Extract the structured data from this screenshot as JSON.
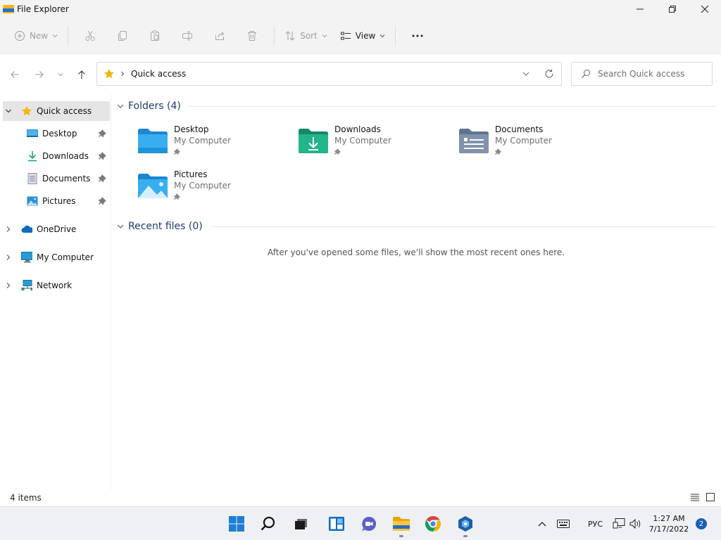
{
  "window": {
    "title": "File Explorer",
    "controls": [
      "minimize-icon",
      "restore-icon",
      "close-icon"
    ]
  },
  "toolbar": {
    "new_label": "New",
    "sort_label": "Sort",
    "view_label": "View",
    "items": [
      "cut-icon",
      "copy-icon",
      "paste-icon",
      "rename-icon",
      "share-icon",
      "delete-icon",
      "more-icon"
    ]
  },
  "address": {
    "path_label": "Quick access",
    "search_placeholder": "Search Quick access"
  },
  "sidebar": {
    "quick_access": "Quick access",
    "pinned": [
      {
        "label": "Desktop",
        "icon": "desktop-icon"
      },
      {
        "label": "Downloads",
        "icon": "downloads-icon"
      },
      {
        "label": "Documents",
        "icon": "documents-icon"
      },
      {
        "label": "Pictures",
        "icon": "pictures-icon"
      }
    ],
    "roots": [
      {
        "label": "OneDrive",
        "icon": "onedrive-icon"
      },
      {
        "label": "My Computer",
        "icon": "computer-icon"
      },
      {
        "label": "Network",
        "icon": "network-icon"
      }
    ]
  },
  "main": {
    "folders_header": "Folders (4)",
    "folders": [
      {
        "name": "Desktop",
        "location": "My Computer",
        "icon": "desktop-folder-icon"
      },
      {
        "name": "Downloads",
        "location": "My Computer",
        "icon": "downloads-folder-icon"
      },
      {
        "name": "Documents",
        "location": "My Computer",
        "icon": "documents-folder-icon"
      },
      {
        "name": "Pictures",
        "location": "My Computer",
        "icon": "pictures-folder-icon"
      }
    ],
    "recent_header": "Recent files (0)",
    "recent_empty": "After you've opened some files, we'll show the most recent ones here."
  },
  "status": {
    "item_count": "4 items"
  },
  "taskbar": {
    "apps": [
      "start-icon",
      "search-icon",
      "task-view-icon",
      "widgets-icon",
      "chat-icon",
      "file-explorer-icon",
      "chrome-icon",
      "app-icon"
    ],
    "language": "РУС",
    "time": "1:27 AM",
    "date": "7/17/2022",
    "notifications": "2"
  },
  "colors": {
    "accent": "#0067c0",
    "folder_blue": "#1e90d6",
    "folder_green": "#1aa37a",
    "star_yellow": "#f4b400",
    "header_text": "#1e3a6b"
  }
}
